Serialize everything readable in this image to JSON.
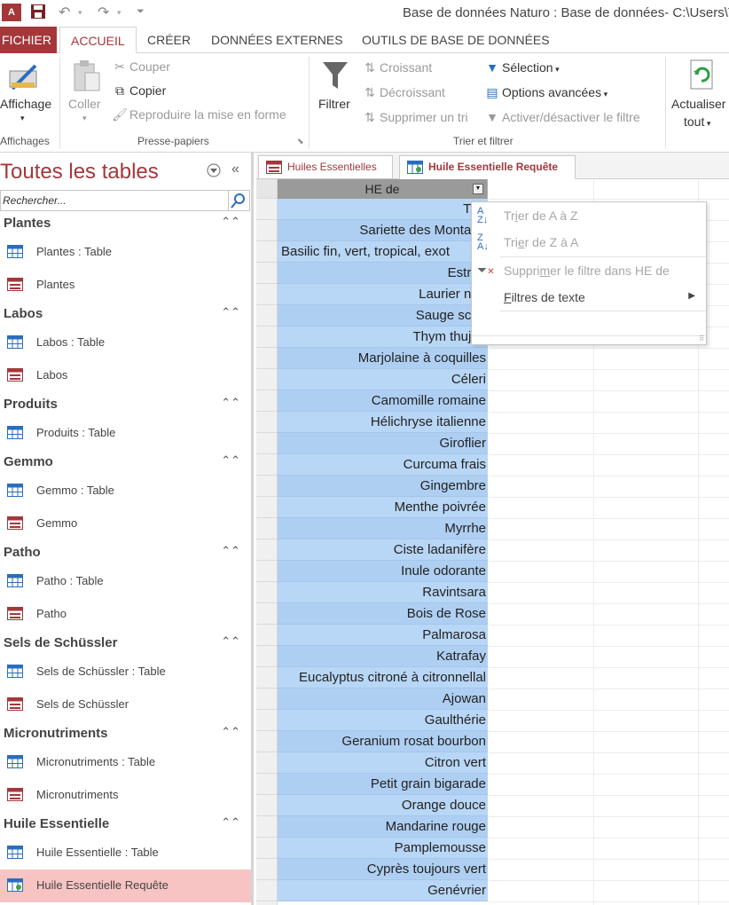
{
  "window": {
    "title": "Base de données Naturo : Base de données- C:\\Users\\Ta",
    "app_icon": "A"
  },
  "ribbon_tabs": [
    {
      "label": "FICHIER"
    },
    {
      "label": "ACCUEIL"
    },
    {
      "label": "CRÉER"
    },
    {
      "label": "DONNÉES EXTERNES"
    },
    {
      "label": "OUTILS DE BASE DE DONNÉES"
    }
  ],
  "ribbon": {
    "affichage": {
      "label": "Affichage",
      "group": "Affichages"
    },
    "clipboard": {
      "coller": "Coller",
      "couper": "Couper",
      "copier": "Copier",
      "reproduire": "Reproduire la mise en forme",
      "group": "Presse-papiers"
    },
    "sort_filter": {
      "filtrer": "Filtrer",
      "croissant": "Croissant",
      "decroissant": "Décroissant",
      "supprimer_tri": "Supprimer un tri",
      "selection": "Sélection",
      "options": "Options avancées",
      "activer": "Activer/désactiver le filtre",
      "group": "Trier et filtrer"
    },
    "actualiser": {
      "line1": "Actualiser",
      "line2": "tout"
    }
  },
  "nav": {
    "title": "Toutes les tables",
    "search_placeholder": "Rechercher...",
    "groups": [
      {
        "name": "Plantes",
        "items": [
          {
            "label": "Plantes : Table",
            "kind": "table"
          },
          {
            "label": "Plantes",
            "kind": "form"
          }
        ]
      },
      {
        "name": "Labos",
        "items": [
          {
            "label": "Labos : Table",
            "kind": "table"
          },
          {
            "label": "Labos",
            "kind": "form"
          }
        ]
      },
      {
        "name": "Produits",
        "items": [
          {
            "label": "Produits : Table",
            "kind": "table"
          }
        ]
      },
      {
        "name": "Gemmo",
        "items": [
          {
            "label": "Gemmo : Table",
            "kind": "table"
          },
          {
            "label": "Gemmo",
            "kind": "form"
          }
        ]
      },
      {
        "name": "Patho",
        "items": [
          {
            "label": "Patho : Table",
            "kind": "table"
          },
          {
            "label": "Patho",
            "kind": "form"
          }
        ]
      },
      {
        "name": "Sels de Schüssler",
        "items": [
          {
            "label": "Sels de Schüssler : Table",
            "kind": "table"
          },
          {
            "label": "Sels de Schüssler",
            "kind": "form"
          }
        ]
      },
      {
        "name": "Micronutriments",
        "items": [
          {
            "label": "Micronutriments : Table",
            "kind": "table"
          },
          {
            "label": "Micronutriments",
            "kind": "form"
          }
        ]
      },
      {
        "name": "Huile Essentielle",
        "items": [
          {
            "label": "Huile Essentielle : Table",
            "kind": "table"
          },
          {
            "label": "Huile Essentielle Requête",
            "kind": "query",
            "selected": true
          },
          {
            "label": "Huiles Essentielles",
            "kind": "form"
          }
        ]
      }
    ]
  },
  "doc_tabs": [
    {
      "label": "Huiles Essentielles",
      "active": false
    },
    {
      "label": "Huile Essentielle Requête",
      "active": true
    }
  ],
  "datasheet": {
    "column_header": "HE de",
    "rows": [
      "Thu",
      "Sariette des Montagn",
      "Basilic fin, vert, tropical, exot",
      "Estrag",
      "Laurier nob",
      "Sauge sclar",
      "Thym thujan",
      "Marjolaine à coquilles",
      "Céleri",
      "Camomille romaine",
      "Hélichryse italienne",
      "Giroflier",
      "Curcuma frais",
      "Gingembre",
      "Menthe poivrée",
      "Myrrhe",
      "Ciste ladanifère",
      "Inule odorante",
      "Ravintsara",
      "Bois de Rose",
      "Palmarosa",
      "Katrafay",
      "Eucalyptus citroné à citronnellal",
      "Ajowan",
      "Gaulthérie",
      "Geranium rosat bourbon",
      "Citron vert",
      "Petit grain bigarade",
      "Orange douce",
      "Mandarine rouge",
      "Pamplemousse",
      "Cyprès toujours vert",
      "Genévrier"
    ]
  },
  "context_menu": {
    "sort_az": {
      "prefix": "Tr",
      "underline": "i",
      "suffix": "er de A à Z",
      "enabled": false
    },
    "sort_za": {
      "prefix": "Tri",
      "underline": "e",
      "suffix": "r de Z à A",
      "enabled": false
    },
    "clear_filter": {
      "prefix": "Suppri",
      "underline": "m",
      "suffix": "er le filtre dans HE de",
      "enabled": false
    },
    "text_filters": {
      "prefix": "",
      "underline": "F",
      "suffix": "iltres de texte",
      "enabled": true
    }
  },
  "colors": {
    "accent": "#a4373a",
    "row_fill": "#b8d6f5",
    "header_fill": "#9a9a9a",
    "selected_nav": "#f8c3c3"
  }
}
